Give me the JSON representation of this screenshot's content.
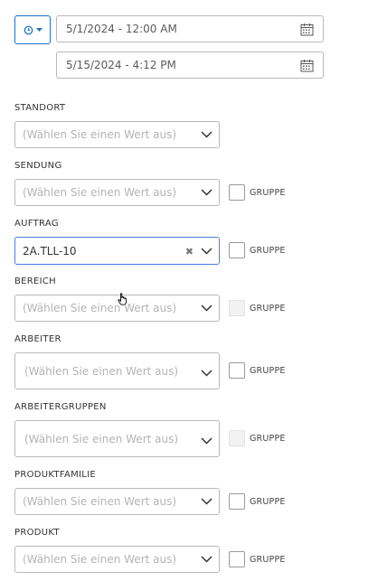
{
  "date_range": {
    "start": "5/1/2024 - 12:00 AM",
    "end": "5/15/2024 - 4:12 PM"
  },
  "group_label": "GRUPPE",
  "placeholder": "(Wählen Sie einen Wert aus)",
  "filters": [
    {
      "label": "STANDORT",
      "value": "",
      "has_group": false
    },
    {
      "label": "SENDUNG",
      "value": "",
      "has_group": true,
      "group_enabled": true
    },
    {
      "label": "AUFTRAG",
      "value": "2A.TLL-10",
      "has_group": true,
      "group_enabled": true
    },
    {
      "label": "BEREICH",
      "value": "",
      "has_group": true,
      "group_enabled": false
    },
    {
      "label": "ARBEITER",
      "value": "",
      "has_group": true,
      "group_enabled": true
    },
    {
      "label": "ARBEITERGRUPPEN",
      "value": "",
      "has_group": true,
      "group_enabled": false
    },
    {
      "label": "PRODUKTFAMILIE",
      "value": "",
      "has_group": true,
      "group_enabled": true
    },
    {
      "label": "PRODUKT",
      "value": "",
      "has_group": true,
      "group_enabled": true
    }
  ],
  "colors": {
    "accent": "#1a73c9",
    "border": "#b9b9b9",
    "placeholder": "#b4b4b4"
  }
}
